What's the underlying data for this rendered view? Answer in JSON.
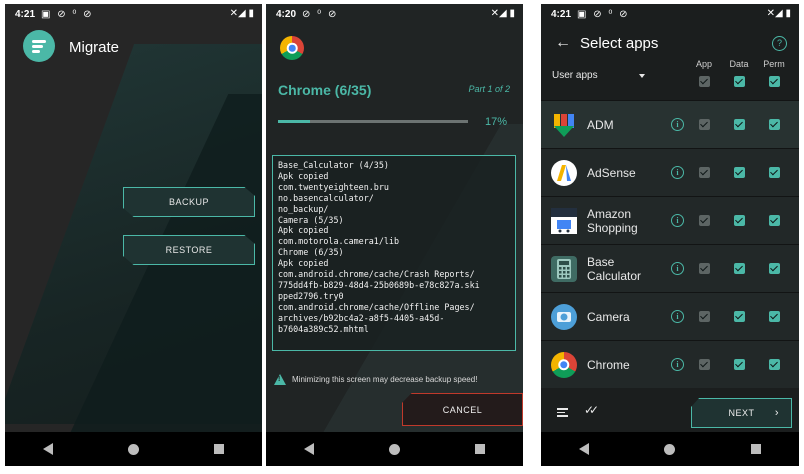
{
  "screen1": {
    "status": {
      "time": "4:21",
      "indicators": "▣ ⊘ ⁰ ⊘",
      "right": "✕◢ ▮"
    },
    "app_title": "Migrate",
    "backup_label": "BACKUP",
    "restore_label": "RESTORE"
  },
  "screen2": {
    "status": {
      "time": "4:20",
      "indicators": "⊘ ⁰ ⊘",
      "right": "✕◢ ▮"
    },
    "package_title": "Chrome (6/35)",
    "part_label": "Part 1 of 2",
    "progress_percent": "17%",
    "progress_value": 0.17,
    "log_lines": [
      "Base_Calculator (4/35)",
      "Apk copied",
      "com.twentyeighteen.bru",
      "no.basencalculator/",
      "no_backup/",
      "Camera (5/35)",
      "Apk copied",
      "com.motorola.camera1/lib",
      "Chrome (6/35)",
      "Apk copied",
      "com.android.chrome/cache/Crash Reports/",
      "775dd4fb-b829-48d4-25b0689b-e78c827a.ski",
      "pped2796.try0",
      "com.android.chrome/cache/Offline Pages/",
      "archives/b92bc4a2-a8f5-4405-a45d-",
      "b7604a389c52.mhtml"
    ],
    "warning": "Minimizing this screen may decrease backup speed!",
    "cancel_label": "CANCEL"
  },
  "screen3": {
    "status": {
      "time": "4:21",
      "indicators": "▣ ⊘ ⁰ ⊘",
      "right": "✕◢ ▮"
    },
    "title": "Select apps",
    "filter_label": "User apps",
    "columns": {
      "app": "App",
      "data": "Data",
      "perm": "Perm"
    },
    "apps": [
      {
        "name": "ADM",
        "icon": "adm-icon"
      },
      {
        "name": "AdSense",
        "icon": "adsense-icon"
      },
      {
        "name": "Amazon\nShopping",
        "icon": "amazon-icon"
      },
      {
        "name": "Base\nCalculator",
        "icon": "calculator-icon"
      },
      {
        "name": "Camera",
        "icon": "camera-icon"
      },
      {
        "name": "Chrome",
        "icon": "chrome-icon"
      }
    ],
    "next_label": "NEXT",
    "accent_color": "#4bb8a7"
  }
}
